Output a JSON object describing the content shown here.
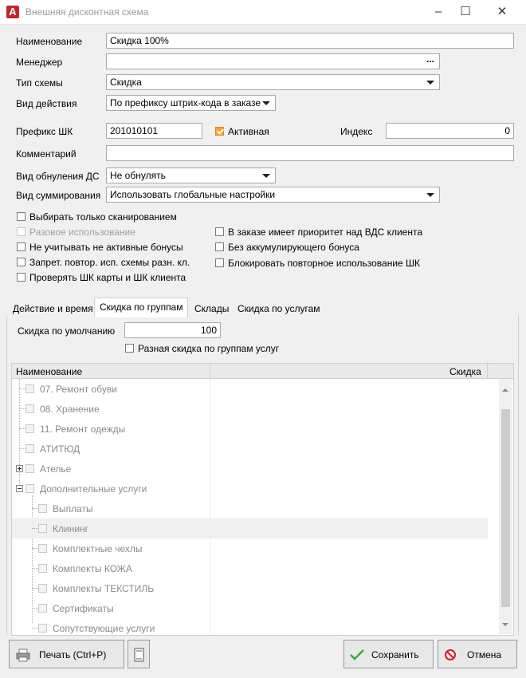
{
  "window": {
    "title": "Внешняя дисконтная схема",
    "app_icon": "app-logo-icon"
  },
  "form": {
    "name_label": "Наименование",
    "name_value": "Скидка 100%",
    "manager_label": "Менеджер",
    "manager_value": "",
    "manager_button": "...",
    "scheme_type_label": "Тип схемы",
    "scheme_type_value": "Скидка",
    "action_type_label": "Вид действия",
    "action_type_value": "По префиксу штрих-кода в заказе",
    "prefix_label": "Префикс ШК",
    "prefix_value": "201010101",
    "active_label": "Активная",
    "active_checked": true,
    "index_label": "Индекс",
    "index_value": "0",
    "comment_label": "Комментарий",
    "comment_value": "",
    "reset_label": "Вид обнуления ДС",
    "reset_value": "Не обнулять",
    "sum_label": "Вид суммирования",
    "sum_value": "Использовать глобальные настройки"
  },
  "options": {
    "scan_only": "Выбирать только сканированием",
    "one_time": "Разовое использование",
    "ignore_inactive": "Не учитывать не активные бонусы",
    "forbid_repeat": "Запрет. повтор. исп. схемы разн. кл.",
    "check_barcodes": "Проверять ШК карты и ШК клиента",
    "priority": "В заказе имеет приоритет над ВДС клиента",
    "no_accum": "Без аккумулирующего бонуса",
    "block_repeat": "Блокировать повторное использование ШК"
  },
  "tabs": [
    {
      "label": "Действие и время"
    },
    {
      "label": "Скидка по группам"
    },
    {
      "label": "Склады"
    },
    {
      "label": "Скидка по услугам"
    }
  ],
  "group_tab": {
    "default_label": "Скидка по умолчанию",
    "default_value": "100",
    "diff_label": "Разная скидка по группам услуг"
  },
  "grid": {
    "col_name": "Наименование",
    "col_discount": "Скидка",
    "rows": [
      {
        "name": "07. Ремонт обуви"
      },
      {
        "name": "08. Хранение"
      },
      {
        "name": "11. Ремонт одежды"
      },
      {
        "name": "АТИТЮД"
      },
      {
        "name": "Ателье"
      },
      {
        "name": "Дополнительные услуги"
      },
      {
        "name": "Выплаты"
      },
      {
        "name": "Клининг"
      },
      {
        "name": "Комплектные чехлы"
      },
      {
        "name": "Комплекты КОЖА"
      },
      {
        "name": "Комплекты ТЕКСТИЛЬ"
      },
      {
        "name": "Сертификаты"
      },
      {
        "name": "Сопутствующие услуги"
      }
    ]
  },
  "buttons": {
    "print": "Печать (Ctrl+P)",
    "save": "Сохранить",
    "cancel": "Отмена"
  }
}
